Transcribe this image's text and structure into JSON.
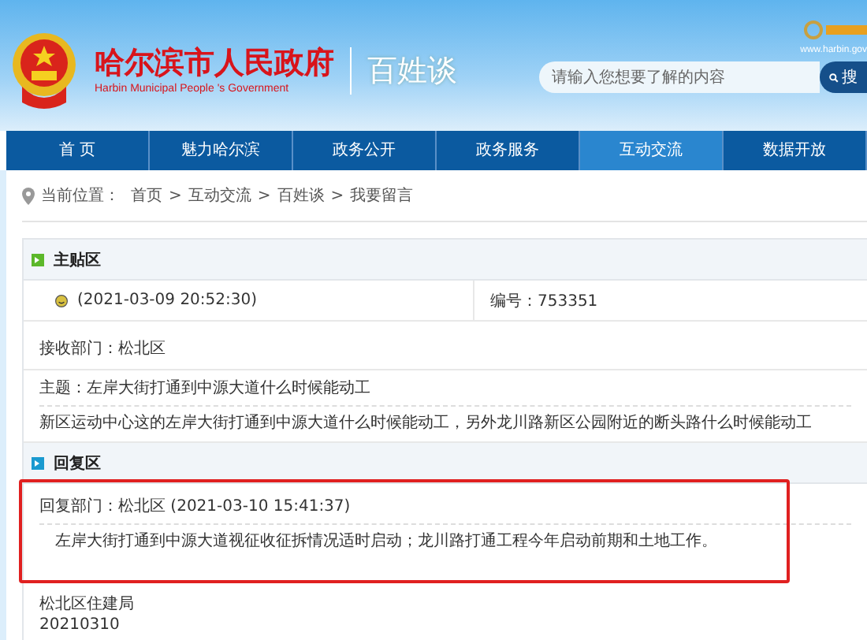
{
  "header": {
    "site_title": "哈尔滨市人民政府",
    "site_subtitle": "Harbin Municipal People 's Government",
    "section_title": "百姓谈",
    "search": {
      "placeholder": "请输入您想要了解的内容",
      "button": "搜"
    },
    "corner_url": "www.harbin.gov"
  },
  "nav": [
    {
      "label": "首 页",
      "selected": false
    },
    {
      "label": "魅力哈尔滨",
      "selected": false
    },
    {
      "label": "政务公开",
      "selected": false
    },
    {
      "label": "政务服务",
      "selected": false
    },
    {
      "label": "互动交流",
      "selected": true
    },
    {
      "label": "数据开放",
      "selected": false
    }
  ],
  "breadcrumb": {
    "prefix": "当前位置：",
    "items": [
      "首页",
      "互动交流",
      "百姓谈",
      "我要留言"
    ],
    "separator": ">"
  },
  "main_post": {
    "heading": "主贴区",
    "time": "(2021-03-09 20:52:30)",
    "number": "编号：753351",
    "department": "接收部门：松北区",
    "subject": "主题：左岸大街打通到中源大道什么时候能动工",
    "body": "新区运动中心这的左岸大街打通到中源大道什么时候能动工，另外龙川路新区公园附近的断头路什么时候能动工"
  },
  "reply": {
    "heading": "回复区",
    "meta": "回复部门：松北区 (2021-03-10 15:41:37)",
    "body": "左岸大街打通到中源大道视征收征拆情况适时启动；龙川路打通工程今年启动前期和土地工作。",
    "signature": "松北区住建局",
    "date": "20210310",
    "highlighted": true
  }
}
